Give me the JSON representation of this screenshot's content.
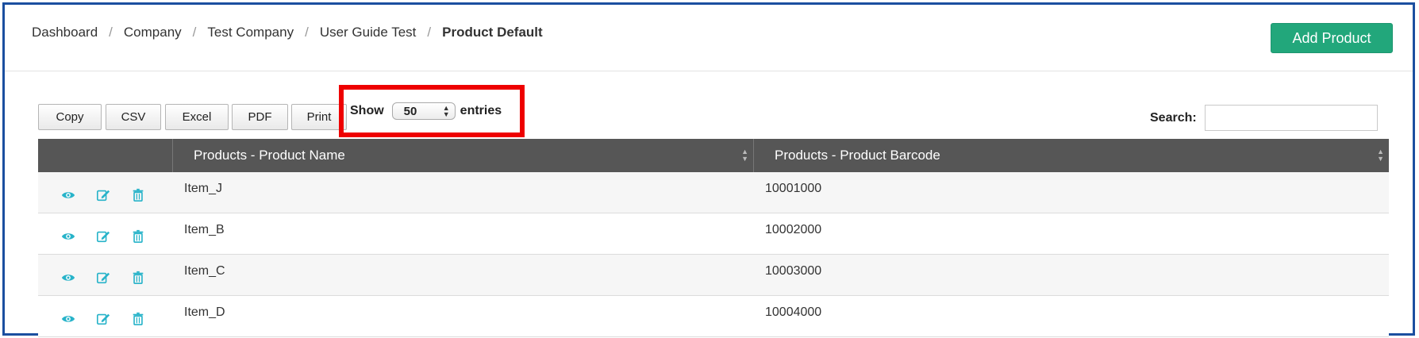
{
  "breadcrumb": {
    "items": [
      "Dashboard",
      "Company",
      "Test Company",
      "User Guide Test"
    ],
    "active": "Product Default",
    "separator": "/"
  },
  "header": {
    "add_button_label": "Add Product"
  },
  "toolbar": {
    "copy_label": "Copy",
    "csv_label": "CSV",
    "excel_label": "Excel",
    "pdf_label": "PDF",
    "print_label": "Print"
  },
  "length_menu": {
    "prefix": "Show",
    "selected": "50",
    "suffix": "entries"
  },
  "search": {
    "label": "Search:",
    "value": "",
    "placeholder": ""
  },
  "table": {
    "columns": [
      "Products - Product Name",
      "Products - Product Barcode"
    ],
    "rows": [
      {
        "name": "Item_J",
        "barcode": "10001000"
      },
      {
        "name": "Item_B",
        "barcode": "10002000"
      },
      {
        "name": "Item_C",
        "barcode": "10003000"
      },
      {
        "name": "Item_D",
        "barcode": "10004000"
      }
    ],
    "action_icons": [
      "view-icon",
      "edit-icon",
      "delete-icon"
    ]
  },
  "colors": {
    "accent": "#22a77b",
    "icon": "#27b3c9",
    "header_bg": "#565656",
    "highlight": "#ee0000",
    "frame": "#1b4fa0"
  }
}
